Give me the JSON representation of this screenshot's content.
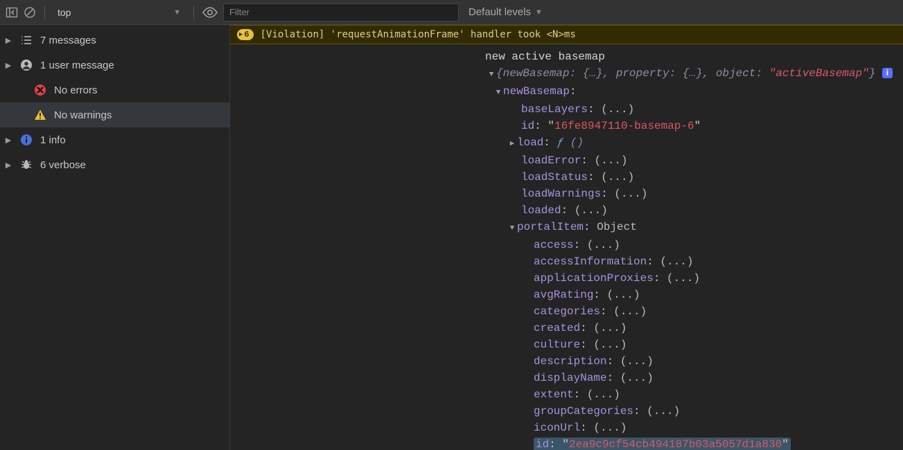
{
  "toolbar": {
    "context": "top",
    "filter_placeholder": "Filter",
    "levels_label": "Default levels"
  },
  "sidebar": {
    "items": [
      {
        "label": "7 messages",
        "icon": "list",
        "arrow": true,
        "indent": false
      },
      {
        "label": "1 user message",
        "icon": "user",
        "arrow": true,
        "indent": false
      },
      {
        "label": "No errors",
        "icon": "error",
        "arrow": false,
        "indent": true
      },
      {
        "label": "No warnings",
        "icon": "warning",
        "arrow": false,
        "indent": true,
        "selected": true
      },
      {
        "label": "1 info",
        "icon": "info",
        "arrow": true,
        "indent": false
      },
      {
        "label": "6 verbose",
        "icon": "bug",
        "arrow": true,
        "indent": false
      }
    ]
  },
  "warning": {
    "count": "6",
    "message": "[Violation] 'requestAnimationFrame' handler took <N>ms"
  },
  "log": {
    "title": "new active basemap",
    "summary": {
      "p1": "newBasemap",
      "p2": "property",
      "p3": "object",
      "v3": "\"activeBasemap\""
    },
    "newBasemap": {
      "key": "newBasemap",
      "props": {
        "baseLayers": "(...)",
        "id_key": "id",
        "id_val": "16fe8947110-basemap-6",
        "load": "load",
        "loadError": "(...)",
        "loadStatus": "(...)",
        "loadWarnings": "(...)",
        "loaded": "(...)"
      },
      "portalItem": {
        "key": "portalItem",
        "type": "Object",
        "props": {
          "access": "(...)",
          "accessInformation": "(...)",
          "applicationProxies": "(...)",
          "avgRating": "(...)",
          "categories": "(...)",
          "created": "(...)",
          "culture": "(...)",
          "description": "(...)",
          "displayName": "(...)",
          "extent": "(...)",
          "groupCategories": "(...)",
          "iconUrl": "(...)",
          "id_key": "id",
          "id_val": "2ea9c9cf54cb494187b03a5057d1a830"
        }
      }
    }
  }
}
